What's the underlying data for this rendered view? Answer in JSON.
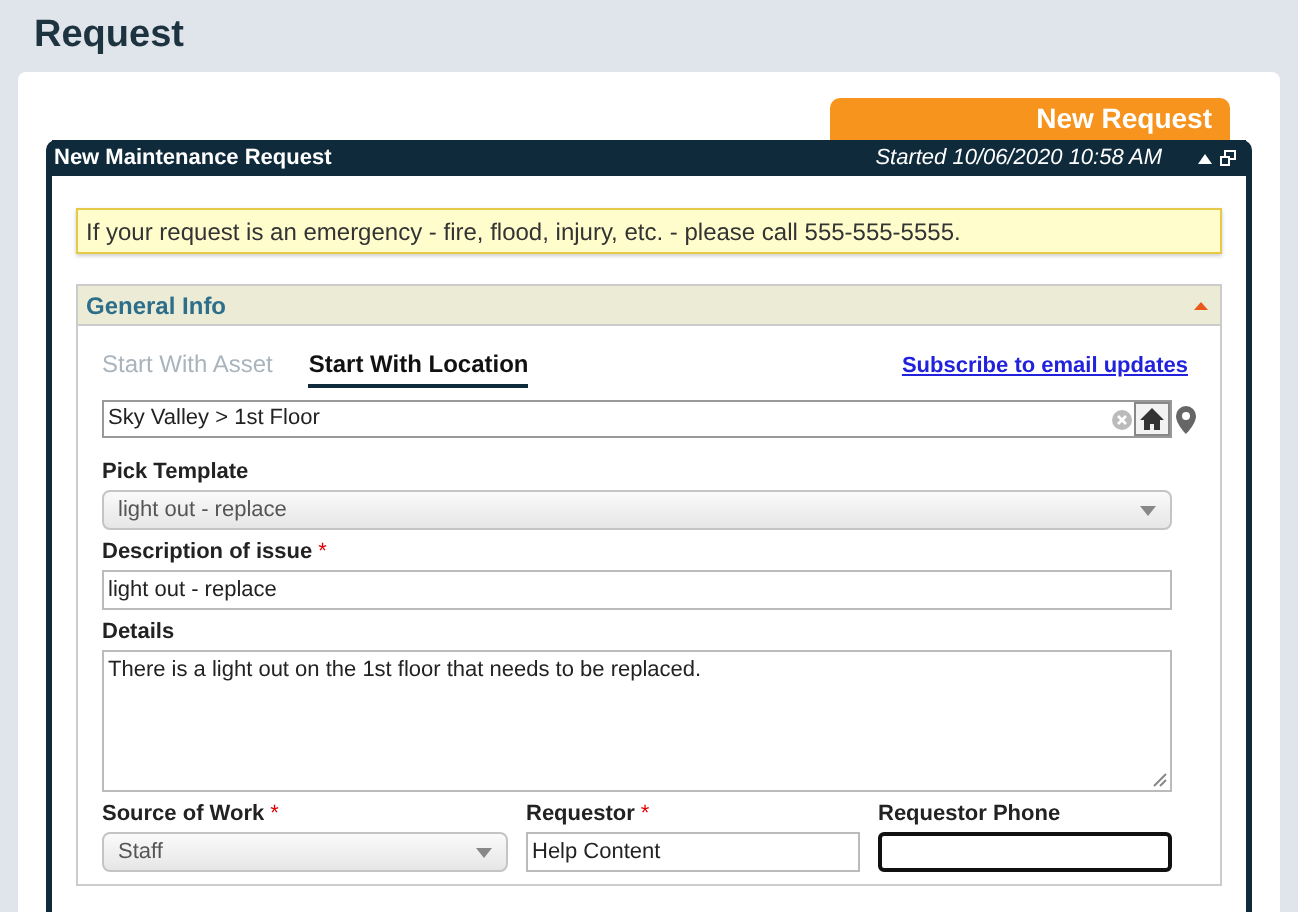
{
  "page_title": "Request",
  "tab_badge": "New Request",
  "panel": {
    "title": "New Maintenance Request",
    "started": "Started 10/06/2020 10:58 AM",
    "collapsed": false
  },
  "alert": "If your request is an emergency - fire, flood, injury, etc. - please call 555-555-5555.",
  "section": {
    "title": "General Info",
    "expanded": true,
    "mode_tabs": [
      {
        "label": "Start With Asset",
        "selected": false
      },
      {
        "label": "Start With Location",
        "selected": true
      }
    ],
    "subscribe_link": "Subscribe to email updates",
    "location": {
      "value": "Sky Valley > 1st Floor"
    },
    "rows": [
      [
        {
          "kind": "select",
          "label": "Pick Template",
          "value": "light out - replace",
          "focused": false
        }
      ],
      [
        {
          "kind": "text",
          "label": "Description of issue",
          "mark": "*",
          "value": "light out - replace",
          "focused": false
        }
      ],
      [
        {
          "kind": "textarea",
          "label": "Details",
          "value": "There is a light out on the 1st floor that needs to be replaced.",
          "focused": false
        }
      ],
      [
        {
          "kind": "select",
          "label": "Source of Work",
          "mark": "*",
          "value": "Staff",
          "focused": false
        },
        {
          "kind": "text",
          "label": "Requestor",
          "mark": "*",
          "value": "Help Content",
          "focused": false
        },
        {
          "kind": "text",
          "label": "Requestor Phone",
          "focused": true
        }
      ]
    ]
  }
}
